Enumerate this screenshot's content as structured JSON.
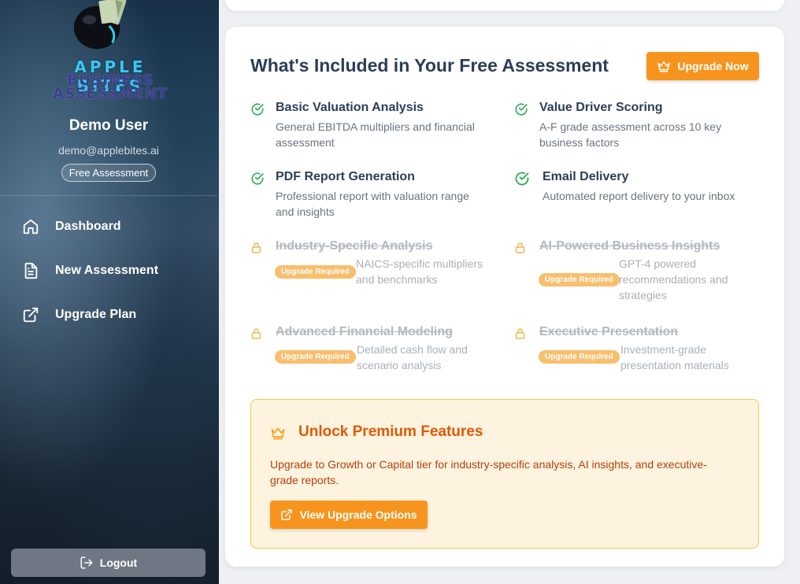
{
  "sidebar": {
    "brand": {
      "line1": "APPLE BITES",
      "line2": "BUSINESS",
      "line3": "ASSESSMENT"
    },
    "user": {
      "name": "Demo User",
      "email": "demo@applebites.ai",
      "tier": "Free Assessment"
    },
    "nav": [
      {
        "label": "Dashboard",
        "icon": "home-icon"
      },
      {
        "label": "New Assessment",
        "icon": "document-icon"
      },
      {
        "label": "Upgrade Plan",
        "icon": "external-link-icon"
      }
    ],
    "logout_label": "Logout"
  },
  "main": {
    "title": "What's Included in Your Free Assessment",
    "upgrade_button": "Upgrade Now",
    "included": [
      {
        "title": "Basic Valuation Analysis",
        "desc": "General EBITDA multipliers and financial assessment"
      },
      {
        "title": "Value Driver Scoring",
        "desc": "A-F grade assessment across 10 key business factors"
      },
      {
        "title": "PDF Report Generation",
        "desc": "Professional report with valuation range and insights"
      },
      {
        "title": "Email Delivery",
        "desc": "Automated report delivery to your inbox"
      }
    ],
    "locked": [
      {
        "title": "Industry-Specific Analysis",
        "desc": "NAICS-specific multipliers and benchmarks",
        "badge": "Upgrade Required"
      },
      {
        "title": "AI-Powered Business Insights",
        "desc": "GPT-4 powered recommendations and strategies",
        "badge": "Upgrade Required"
      },
      {
        "title": "Advanced Financial Modeling",
        "desc": "Detailed cash flow and scenario analysis",
        "badge": "Upgrade Required"
      },
      {
        "title": "Executive Presentation",
        "desc": "Investment-grade presentation materials",
        "badge": "Upgrade Required"
      }
    ],
    "promo": {
      "title": "Unlock Premium Features",
      "text": "Upgrade to Growth or Capital tier for industry-specific analysis, AI insights, and executive-grade reports.",
      "button": "View Upgrade Options"
    }
  },
  "colors": {
    "accent": "#f7941d",
    "check": "#2fae5a",
    "lock": "#f4b040",
    "heading": "#2c3e57"
  }
}
